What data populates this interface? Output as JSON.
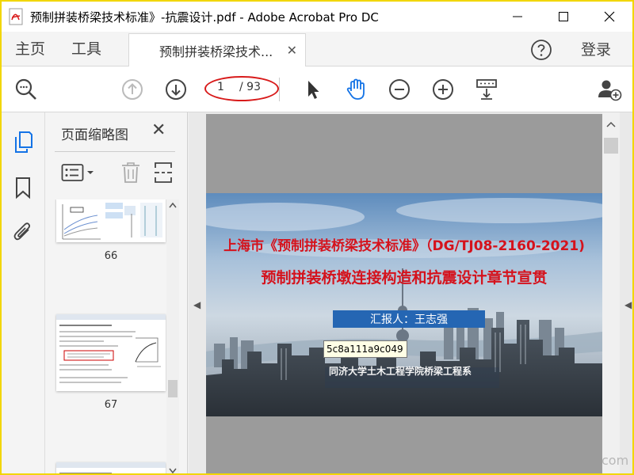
{
  "window": {
    "title": "预制拼装桥梁技术标准》-抗震设计.pdf - Adobe Acrobat Pro DC"
  },
  "tabs": {
    "home": "主页",
    "tools": "工具",
    "document": "预制拼装桥梁技术...",
    "login": "登录"
  },
  "toolbar": {
    "current_page": "1",
    "total_pages": "/ 93"
  },
  "sidebar": {
    "title": "页面缩略图",
    "thumbnails": [
      {
        "page": "66"
      },
      {
        "page": "67"
      }
    ]
  },
  "slide": {
    "title_line1": "上海市《预制拼装桥梁技术标准》（DG/TJ08-2160-2021)",
    "title_line2": "预制拼装桥墩连接构造和抗震设计章节宣贯",
    "reporter": "汇报人：王志强",
    "affiliation": "同济大学土木工程学院桥梁工程系"
  },
  "tooltip": "5c8a111a9c049",
  "watermark": "com",
  "colors": {
    "frame_border": "#f2d600",
    "oval_highlight": "#d81a1a",
    "title_red": "#d5121c",
    "reporter_blue": "#2566b3",
    "icon_blue": "#1473e6"
  }
}
